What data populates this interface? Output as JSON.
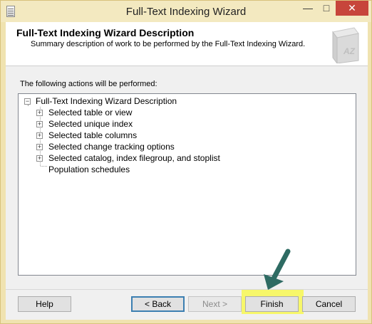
{
  "window": {
    "title": "Full-Text Indexing Wizard",
    "controls": {
      "minimize": "—",
      "maximize": "□",
      "close": "✕"
    }
  },
  "header": {
    "title": "Full-Text Indexing Wizard Description",
    "subtitle": "Summary description of work to be performed by the Full-Text Indexing Wizard."
  },
  "main": {
    "actions_label": "The following actions will be performed:",
    "tree": {
      "root": {
        "label": "Full-Text Indexing Wizard Description",
        "expander": "−"
      },
      "children": [
        {
          "label": "Selected table or view",
          "expander": "+"
        },
        {
          "label": "Selected unique index",
          "expander": "+"
        },
        {
          "label": "Selected table columns",
          "expander": "+"
        },
        {
          "label": "Selected change tracking options",
          "expander": "+"
        },
        {
          "label": "Selected catalog, index filegroup, and stoplist",
          "expander": "+"
        },
        {
          "label": "Population schedules",
          "expander": ""
        }
      ]
    }
  },
  "footer": {
    "help": "Help",
    "back": "< Back",
    "next": "Next >",
    "finish": "Finish",
    "cancel": "Cancel"
  },
  "colors": {
    "highlight": "#f7f76a",
    "arrow": "#2e6b63",
    "close_button": "#c7453b"
  }
}
